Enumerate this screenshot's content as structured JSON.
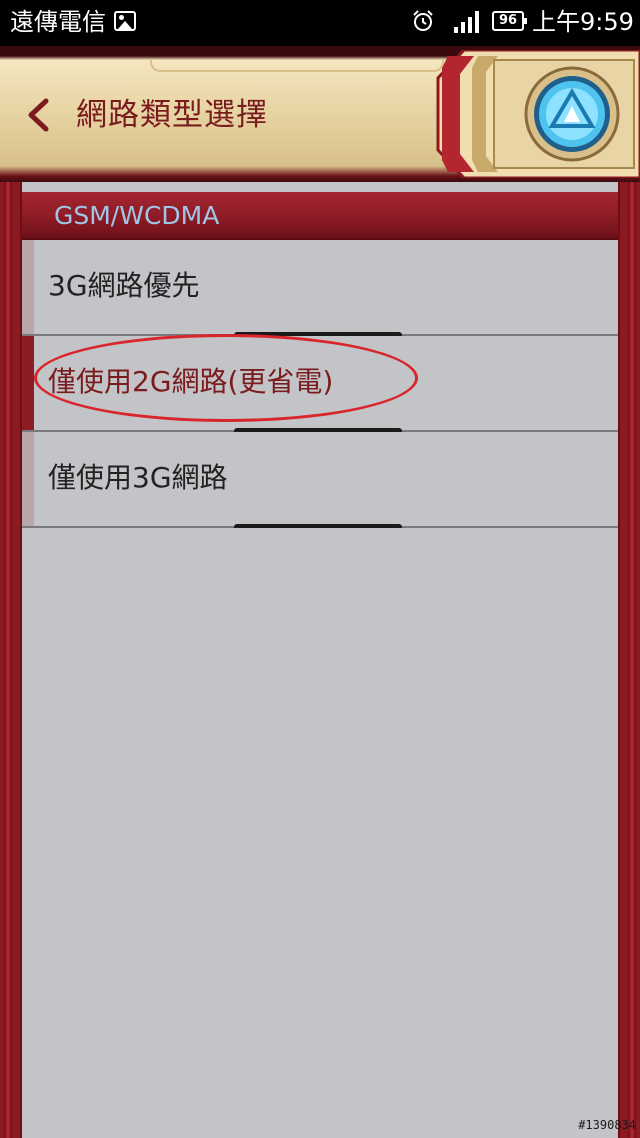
{
  "status_bar": {
    "carrier": "遠傳電信",
    "battery_level": "96",
    "time": "上午9:59",
    "icons": [
      "image-icon",
      "alarm-icon",
      "signal-icon",
      "battery-icon"
    ]
  },
  "header": {
    "title": "網路類型選擇",
    "back_icon": "chevron-left-icon",
    "decoration_icon": "arc-reactor-icon"
  },
  "section": {
    "label": "GSM/WCDMA"
  },
  "options": [
    {
      "label": "3G網路優先",
      "selected": false
    },
    {
      "label": "僅使用2G網路(更省電)",
      "selected": true
    },
    {
      "label": "僅使用3G網路",
      "selected": false
    }
  ],
  "watermark": "#1390834",
  "colors": {
    "accent": "#8e1c24",
    "section_text": "#9fc6e6",
    "title_text": "#7a1b1e",
    "highlight_ellipse": "#d8262c",
    "list_background": "#c3c4c7"
  }
}
